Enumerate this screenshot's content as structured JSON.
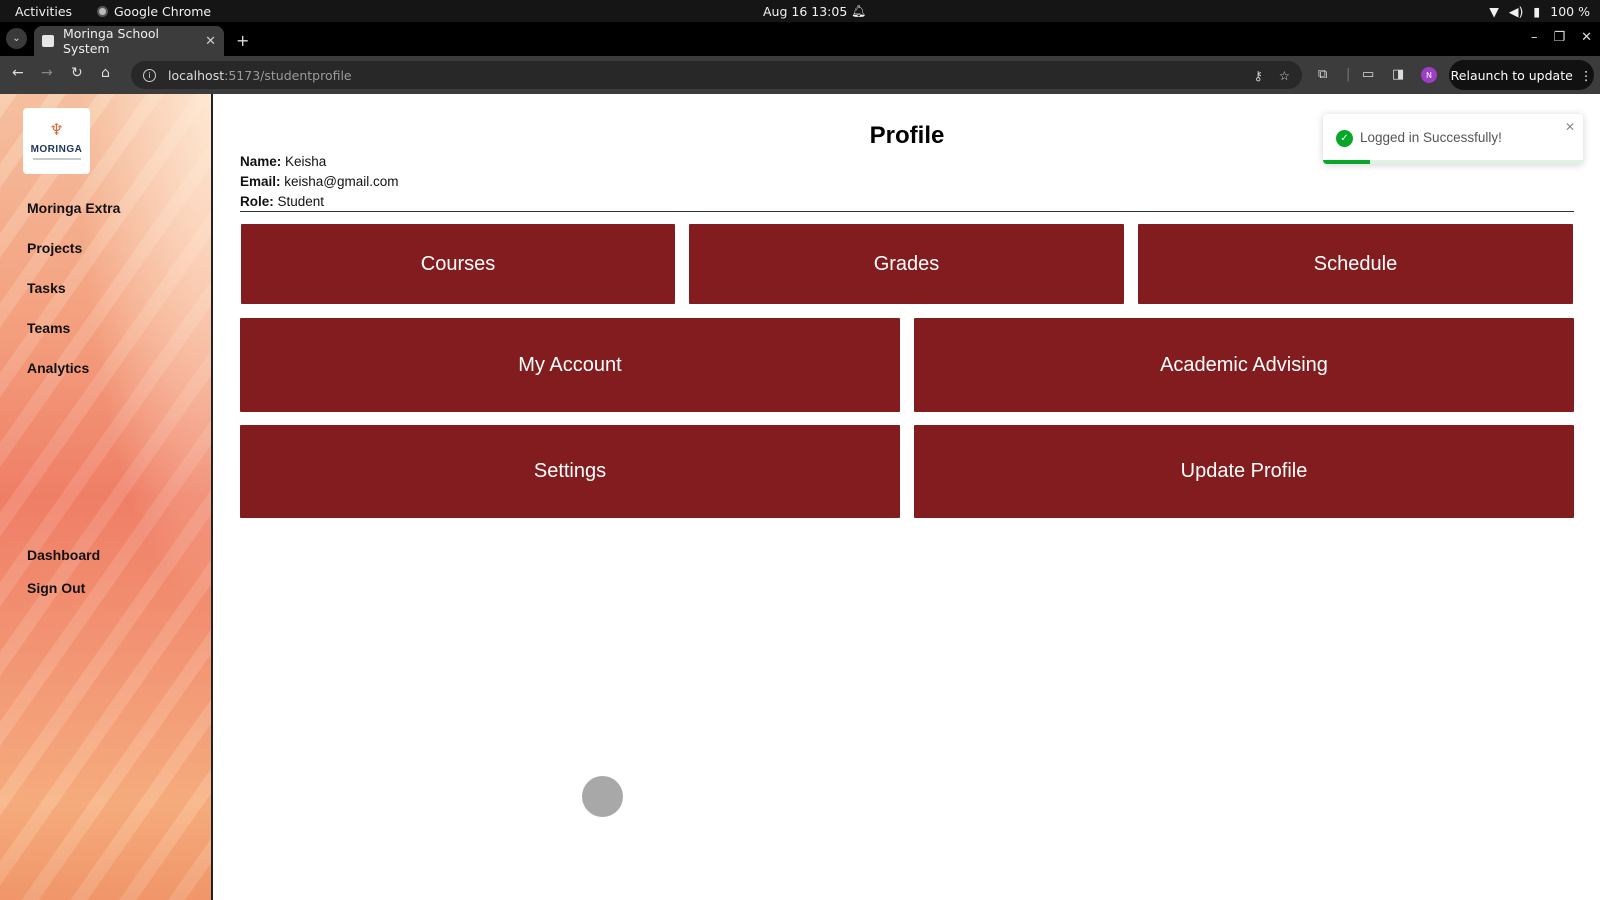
{
  "system_bar": {
    "activities": "Activities",
    "app_name": "Google Chrome",
    "datetime": "Aug 16  13:05",
    "battery": "100 %"
  },
  "browser": {
    "tab_title": "Moringa School System",
    "url_host": "localhost",
    "url_path": ":5173/studentprofile",
    "profile_initial": "N",
    "relaunch_label": "Relaunch to update"
  },
  "sidebar": {
    "logo_text": "MORINGA",
    "top_links": [
      "Moringa Extra",
      "Projects",
      "Tasks",
      "Teams",
      "Analytics"
    ],
    "bottom_links": [
      "Dashboard",
      "Sign Out"
    ]
  },
  "profile": {
    "title": "Profile",
    "name_label": "Name:",
    "name": "Keisha",
    "email_label": "Email:",
    "email": "keisha@gmail.com",
    "role_label": "Role:",
    "role": "Student"
  },
  "cards": {
    "row1": [
      "Courses",
      "Grades",
      "Schedule"
    ],
    "row2": [
      "My Account",
      "Academic Advising"
    ],
    "row3": [
      "Settings",
      "Update Profile"
    ]
  },
  "toast": {
    "message": "Logged in Successfully!",
    "progress": 0.18
  },
  "colors": {
    "card": "#821c1e",
    "success": "#07a82a"
  }
}
